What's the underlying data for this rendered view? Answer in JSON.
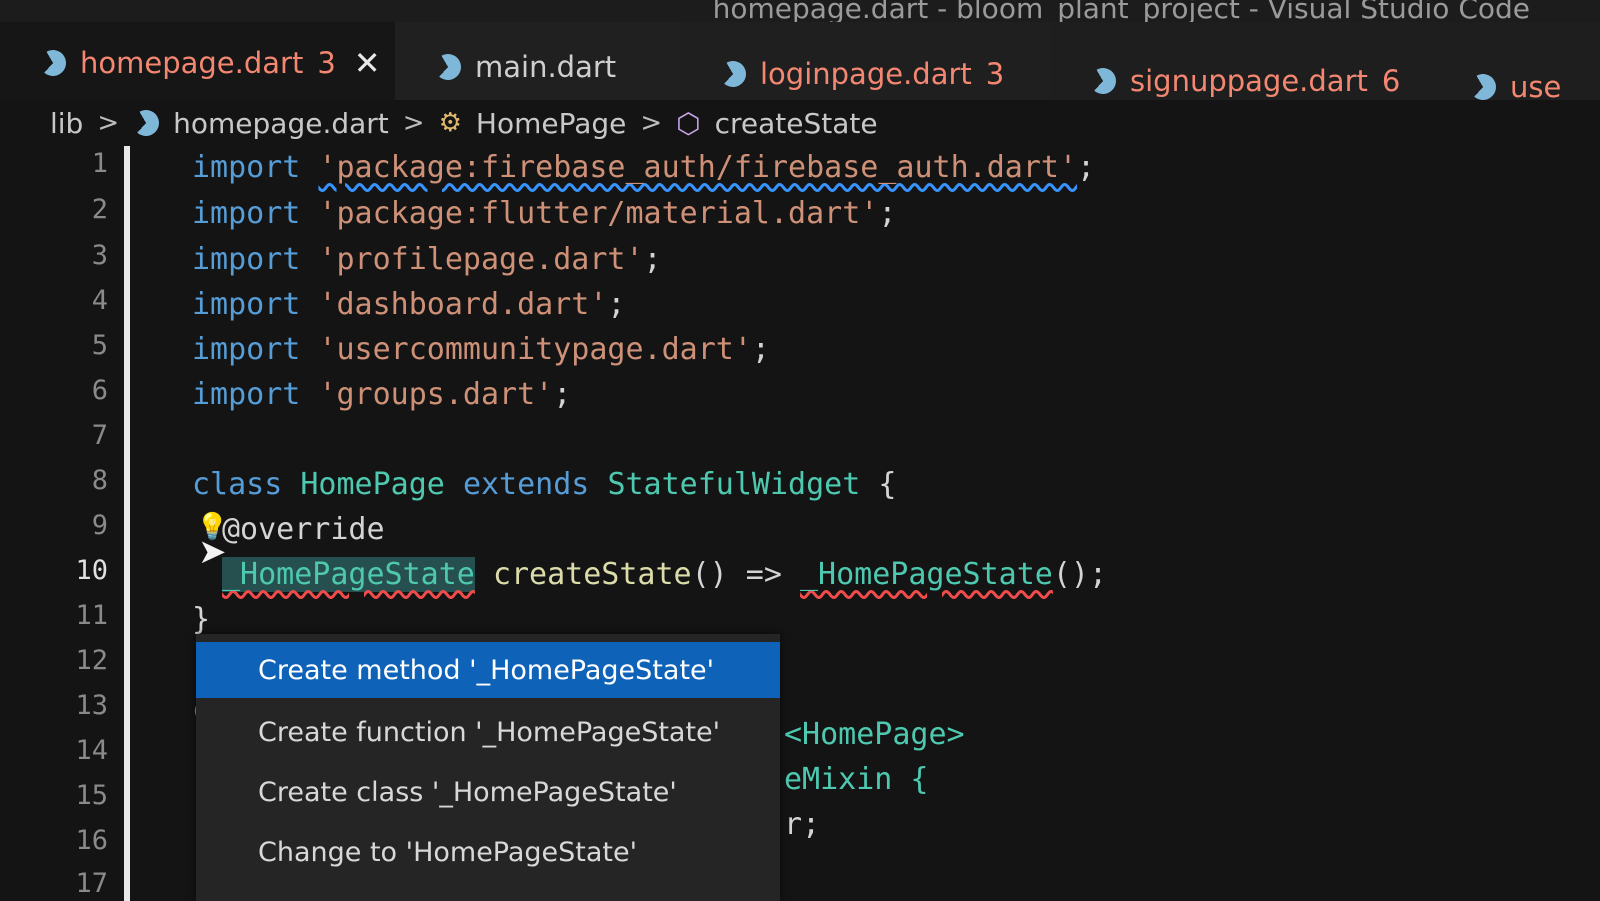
{
  "window": {
    "title": "homepage.dart - bloom_plant_project - Visual Studio Code"
  },
  "tabs": [
    {
      "label": "homepage.dart",
      "count": "3",
      "active": true,
      "close": "✕"
    },
    {
      "label": "main.dart",
      "count": "",
      "active": false
    },
    {
      "label": "loginpage.dart",
      "count": "3",
      "active": false
    },
    {
      "label": "signuppage.dart",
      "count": "6",
      "active": false
    },
    {
      "label": "use",
      "count": "",
      "active": false
    }
  ],
  "breadcrumbs": {
    "folder": "lib",
    "file": "homepage.dart",
    "class": "HomePage",
    "method": "createState",
    "separator": ">"
  },
  "line_numbers": [
    "1",
    "2",
    "3",
    "4",
    "5",
    "6",
    "7",
    "8",
    "9",
    "10",
    "11",
    "12",
    "13",
    "14",
    "15",
    "16",
    "17"
  ],
  "code": {
    "l1": {
      "kw": "import",
      "str": "'package:firebase_auth/firebase_auth.dart'",
      "end": ";"
    },
    "l2": {
      "kw": "import",
      "str": "'package:flutter/material.dart'",
      "end": ";"
    },
    "l3": {
      "kw": "import",
      "str": "'profilepage.dart'",
      "end": ";"
    },
    "l4": {
      "kw": "import",
      "str": "'dashboard.dart'",
      "end": ";"
    },
    "l5": {
      "kw": "import",
      "str": "'usercommunitypage.dart'",
      "end": ";"
    },
    "l6": {
      "kw": "import",
      "str": "'groups.dart'",
      "end": ";"
    },
    "l8": {
      "kw1": "class",
      "name": "HomePage",
      "kw2": "extends",
      "base": "StatefulWidget",
      "brace": "{"
    },
    "l9": {
      "anno": "@override"
    },
    "l10": {
      "ret": "_HomePageState",
      "fn": "createState",
      "mid": "() =>",
      "call": "_HomePageState",
      "end": "();"
    },
    "l11": {
      "brace": "}"
    },
    "l13": {
      "start": "c",
      "tail": "<HomePage>"
    },
    "l14": {
      "tail": "eMixin {"
    },
    "l15": {
      "tail": "r;"
    }
  },
  "quickfix": {
    "items": [
      {
        "label": "Create method '_HomePageState'",
        "selected": true
      },
      {
        "label": "Create function '_HomePageState'",
        "selected": false
      },
      {
        "label": "Create class '_HomePageState'",
        "selected": false
      },
      {
        "label": "Change to 'HomePageState'",
        "selected": false
      }
    ]
  },
  "colors": {
    "keyword": "#569cd6",
    "string": "#ce9178",
    "type": "#4ec9b0",
    "function": "#dcdcaa",
    "error": "#f14c4c",
    "selection": "#0e63b8"
  },
  "icons": {
    "tab_file": "dart-icon",
    "breadcrumb_class": "class-icon",
    "breadcrumb_method": "method-cube-icon",
    "lightbulb": "lightbulb-icon",
    "cursor": "mouse-cursor-icon"
  }
}
